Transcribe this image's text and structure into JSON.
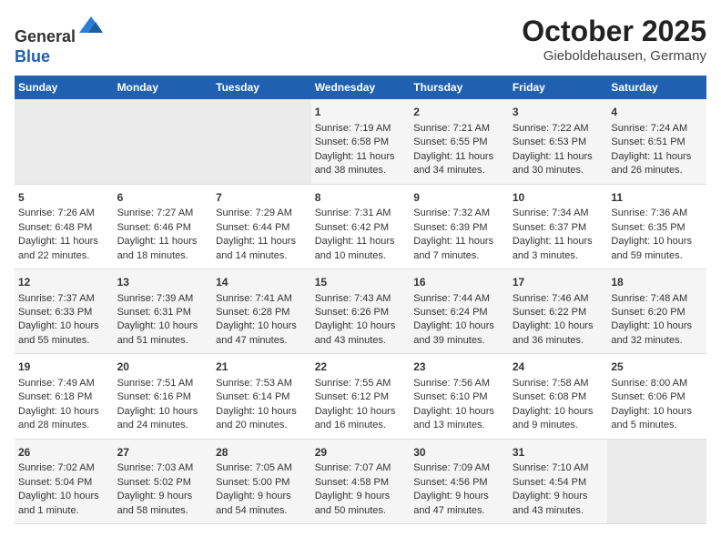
{
  "header": {
    "logo_line1": "General",
    "logo_line2": "Blue",
    "month_title": "October 2025",
    "location": "Gieboldehausen, Germany"
  },
  "weekdays": [
    "Sunday",
    "Monday",
    "Tuesday",
    "Wednesday",
    "Thursday",
    "Friday",
    "Saturday"
  ],
  "weeks": [
    [
      {
        "day": "",
        "empty": true
      },
      {
        "day": "",
        "empty": true
      },
      {
        "day": "",
        "empty": true
      },
      {
        "day": "1",
        "sunrise": "7:19 AM",
        "sunset": "6:58 PM",
        "daylight": "11 hours and 38 minutes."
      },
      {
        "day": "2",
        "sunrise": "7:21 AM",
        "sunset": "6:55 PM",
        "daylight": "11 hours and 34 minutes."
      },
      {
        "day": "3",
        "sunrise": "7:22 AM",
        "sunset": "6:53 PM",
        "daylight": "11 hours and 30 minutes."
      },
      {
        "day": "4",
        "sunrise": "7:24 AM",
        "sunset": "6:51 PM",
        "daylight": "11 hours and 26 minutes."
      }
    ],
    [
      {
        "day": "5",
        "sunrise": "7:26 AM",
        "sunset": "6:48 PM",
        "daylight": "11 hours and 22 minutes."
      },
      {
        "day": "6",
        "sunrise": "7:27 AM",
        "sunset": "6:46 PM",
        "daylight": "11 hours and 18 minutes."
      },
      {
        "day": "7",
        "sunrise": "7:29 AM",
        "sunset": "6:44 PM",
        "daylight": "11 hours and 14 minutes."
      },
      {
        "day": "8",
        "sunrise": "7:31 AM",
        "sunset": "6:42 PM",
        "daylight": "11 hours and 10 minutes."
      },
      {
        "day": "9",
        "sunrise": "7:32 AM",
        "sunset": "6:39 PM",
        "daylight": "11 hours and 7 minutes."
      },
      {
        "day": "10",
        "sunrise": "7:34 AM",
        "sunset": "6:37 PM",
        "daylight": "11 hours and 3 minutes."
      },
      {
        "day": "11",
        "sunrise": "7:36 AM",
        "sunset": "6:35 PM",
        "daylight": "10 hours and 59 minutes."
      }
    ],
    [
      {
        "day": "12",
        "sunrise": "7:37 AM",
        "sunset": "6:33 PM",
        "daylight": "10 hours and 55 minutes."
      },
      {
        "day": "13",
        "sunrise": "7:39 AM",
        "sunset": "6:31 PM",
        "daylight": "10 hours and 51 minutes."
      },
      {
        "day": "14",
        "sunrise": "7:41 AM",
        "sunset": "6:28 PM",
        "daylight": "10 hours and 47 minutes."
      },
      {
        "day": "15",
        "sunrise": "7:43 AM",
        "sunset": "6:26 PM",
        "daylight": "10 hours and 43 minutes."
      },
      {
        "day": "16",
        "sunrise": "7:44 AM",
        "sunset": "6:24 PM",
        "daylight": "10 hours and 39 minutes."
      },
      {
        "day": "17",
        "sunrise": "7:46 AM",
        "sunset": "6:22 PM",
        "daylight": "10 hours and 36 minutes."
      },
      {
        "day": "18",
        "sunrise": "7:48 AM",
        "sunset": "6:20 PM",
        "daylight": "10 hours and 32 minutes."
      }
    ],
    [
      {
        "day": "19",
        "sunrise": "7:49 AM",
        "sunset": "6:18 PM",
        "daylight": "10 hours and 28 minutes."
      },
      {
        "day": "20",
        "sunrise": "7:51 AM",
        "sunset": "6:16 PM",
        "daylight": "10 hours and 24 minutes."
      },
      {
        "day": "21",
        "sunrise": "7:53 AM",
        "sunset": "6:14 PM",
        "daylight": "10 hours and 20 minutes."
      },
      {
        "day": "22",
        "sunrise": "7:55 AM",
        "sunset": "6:12 PM",
        "daylight": "10 hours and 16 minutes."
      },
      {
        "day": "23",
        "sunrise": "7:56 AM",
        "sunset": "6:10 PM",
        "daylight": "10 hours and 13 minutes."
      },
      {
        "day": "24",
        "sunrise": "7:58 AM",
        "sunset": "6:08 PM",
        "daylight": "10 hours and 9 minutes."
      },
      {
        "day": "25",
        "sunrise": "8:00 AM",
        "sunset": "6:06 PM",
        "daylight": "10 hours and 5 minutes."
      }
    ],
    [
      {
        "day": "26",
        "sunrise": "7:02 AM",
        "sunset": "5:04 PM",
        "daylight": "10 hours and 1 minute."
      },
      {
        "day": "27",
        "sunrise": "7:03 AM",
        "sunset": "5:02 PM",
        "daylight": "9 hours and 58 minutes."
      },
      {
        "day": "28",
        "sunrise": "7:05 AM",
        "sunset": "5:00 PM",
        "daylight": "9 hours and 54 minutes."
      },
      {
        "day": "29",
        "sunrise": "7:07 AM",
        "sunset": "4:58 PM",
        "daylight": "9 hours and 50 minutes."
      },
      {
        "day": "30",
        "sunrise": "7:09 AM",
        "sunset": "4:56 PM",
        "daylight": "9 hours and 47 minutes."
      },
      {
        "day": "31",
        "sunrise": "7:10 AM",
        "sunset": "4:54 PM",
        "daylight": "9 hours and 43 minutes."
      },
      {
        "day": "",
        "empty": true
      }
    ]
  ],
  "labels": {
    "sunrise": "Sunrise:",
    "sunset": "Sunset:",
    "daylight": "Daylight:"
  }
}
